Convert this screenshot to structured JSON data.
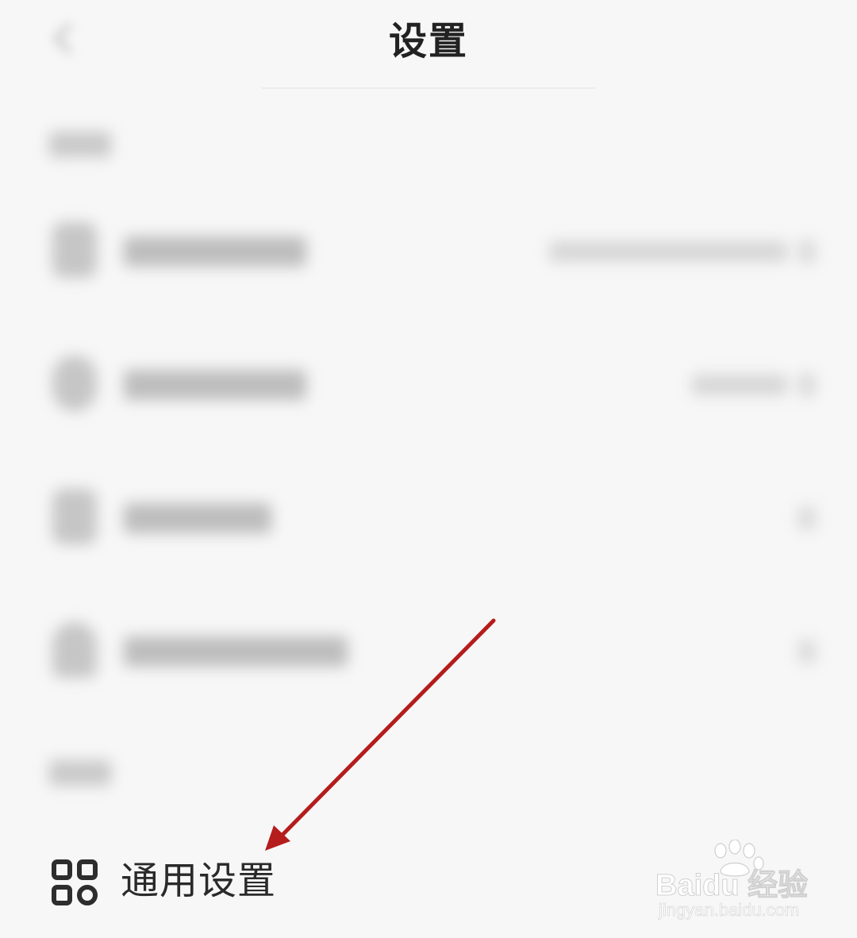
{
  "header": {
    "title": "设置"
  },
  "general_settings": {
    "label": "通用设置",
    "icon": "grid-apps-icon"
  },
  "annotation": {
    "arrow_color": "#b51c1c"
  },
  "watermark": {
    "brand": "Baidu 经验",
    "url": "jingyan.baidu.com"
  },
  "colors": {
    "background": "#f7f7f7",
    "text": "#222222"
  }
}
